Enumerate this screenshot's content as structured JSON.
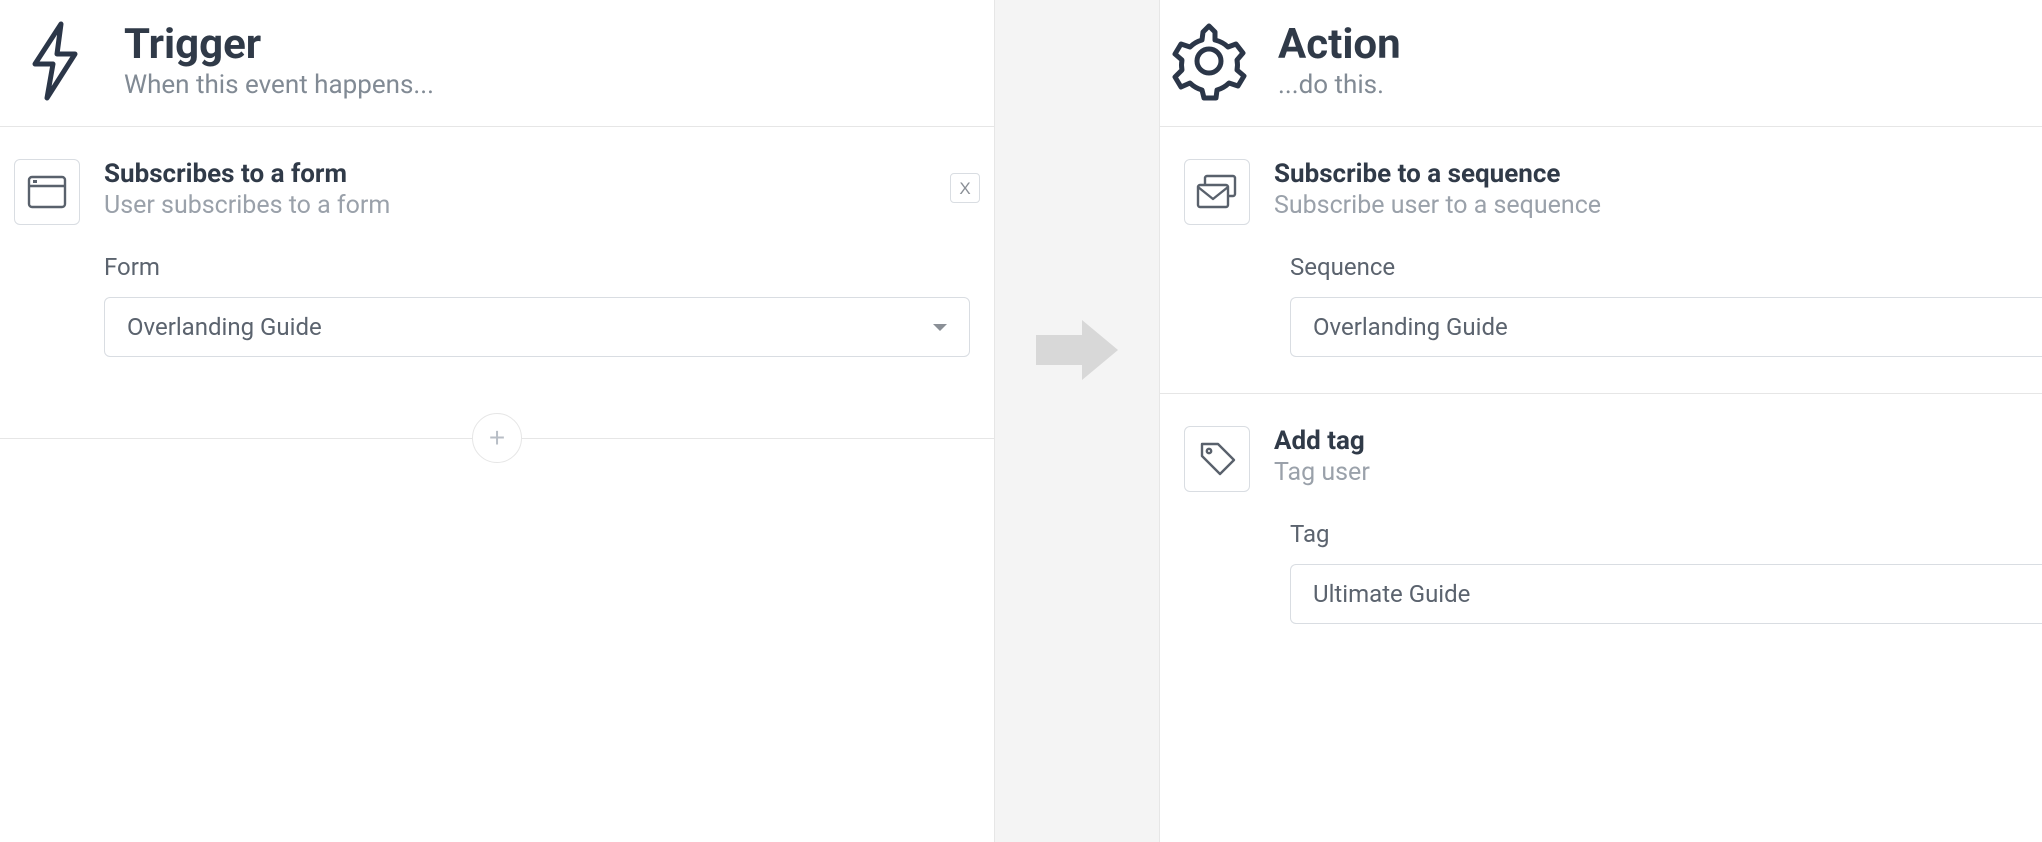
{
  "trigger": {
    "title": "Trigger",
    "subtitle": "When this event happens...",
    "events": [
      {
        "title": "Subscribes to a form",
        "subtitle": "User subscribes to a form",
        "remove_label": "X",
        "field_label": "Form",
        "field_value": "Overlanding Guide"
      }
    ],
    "add_label": "+"
  },
  "action": {
    "title": "Action",
    "subtitle": "...do this.",
    "steps": [
      {
        "kind": "sequence",
        "title": "Subscribe to a sequence",
        "subtitle": "Subscribe user to a sequence",
        "field_label": "Sequence",
        "field_value": "Overlanding Guide"
      },
      {
        "kind": "tag",
        "title": "Add tag",
        "subtitle": "Tag user",
        "field_label": "Tag",
        "field_value": "Ultimate Guide"
      }
    ]
  }
}
